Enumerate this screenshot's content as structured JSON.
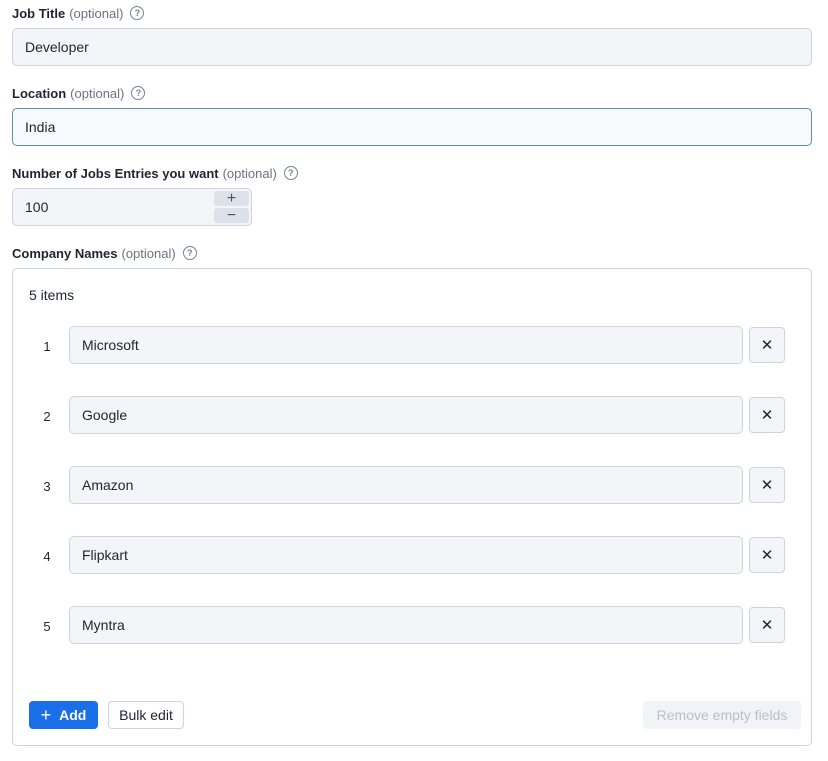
{
  "job_title": {
    "label": "Job Title",
    "optional": "(optional)",
    "value": "Developer"
  },
  "location": {
    "label": "Location",
    "optional": "(optional)",
    "value": "India"
  },
  "num_jobs": {
    "label": "Number of Jobs Entries you want",
    "optional": "(optional)",
    "value": "100",
    "increment": "+",
    "decrement": "−"
  },
  "companies": {
    "label": "Company Names",
    "optional": "(optional)",
    "count_text": "5 items",
    "items": [
      {
        "index": "1",
        "value": "Microsoft"
      },
      {
        "index": "2",
        "value": "Google"
      },
      {
        "index": "3",
        "value": "Amazon"
      },
      {
        "index": "4",
        "value": "Flipkart"
      },
      {
        "index": "5",
        "value": "Myntra"
      }
    ],
    "remove_glyph": "✕",
    "add_label": "Add",
    "add_glyph": "+",
    "bulk_edit_label": "Bulk edit",
    "remove_empty_label": "Remove empty fields"
  },
  "help_glyph": "?",
  "colors": {
    "primary": "#1a6ee8",
    "focus_border": "#5b8fa8",
    "field_bg": "#f4f5f9"
  }
}
